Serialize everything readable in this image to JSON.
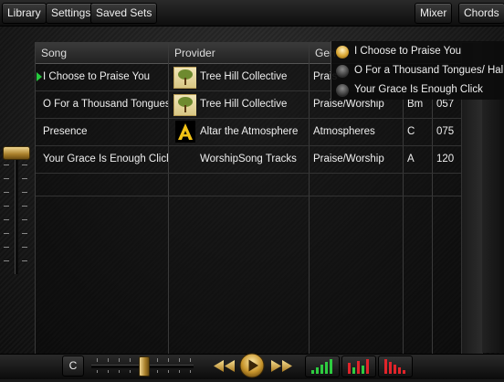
{
  "toolbar": {
    "library": "Library",
    "settings": "Settings",
    "saved_sets": "Saved Sets",
    "mixer": "Mixer",
    "chords": "Chords"
  },
  "table": {
    "headers": {
      "song": "Song",
      "provider": "Provider",
      "genre": "Gen"
    },
    "rows": [
      {
        "song": "I Choose to Praise You",
        "provider": "Tree Hill Collective",
        "genre": "Prais",
        "key": "",
        "tempo": "",
        "thumb": "tree-thumbnail",
        "current": true
      },
      {
        "song": "O For a Thousand Tongues",
        "provider": "Tree Hill Collective",
        "genre": "Praise/Worship",
        "key": "Bm",
        "tempo": "057",
        "thumb": "tree-thumbnail"
      },
      {
        "song": "Presence",
        "provider": "Altar the Atmosphere",
        "genre": "Atmospheres",
        "key": "C",
        "tempo": "075",
        "thumb": "altar-a-thumbnail"
      },
      {
        "song": "Your Grace Is Enough Click",
        "provider": "WorshipSong Tracks",
        "genre": "Praise/Worship",
        "key": "A",
        "tempo": "120",
        "thumb": ""
      }
    ]
  },
  "setlist_dropdown": [
    {
      "label": "I Choose to Praise You",
      "active": true
    },
    {
      "label": "O For a Thousand Tongues/ Hal",
      "active": false
    },
    {
      "label": "Your Grace Is Enough Click",
      "active": false
    }
  ],
  "bottom": {
    "key_button": "C",
    "colors": {
      "accent_gold": "#d9a531",
      "meter_green": "#2ecc40",
      "meter_red": "#e0242a"
    }
  }
}
